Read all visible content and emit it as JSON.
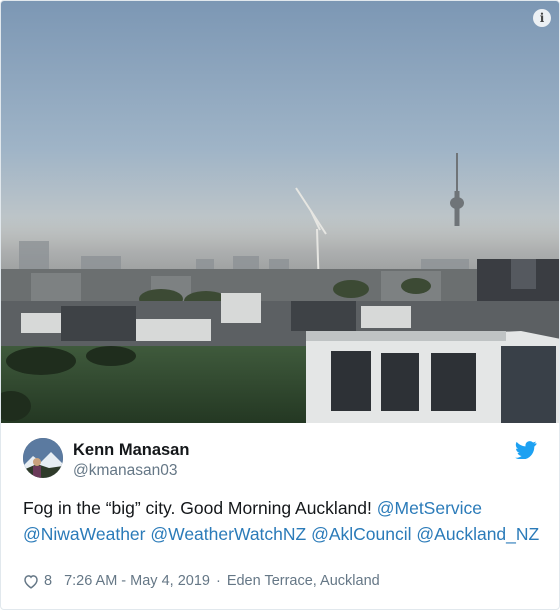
{
  "colors": {
    "link": "#2b7bb9",
    "secondary_text": "#657786",
    "twitter_blue": "#1da1f2",
    "sky_top": "#7f99b5",
    "sky_horizon": "#d9cdb8"
  },
  "media": {
    "info_icon": "info-icon",
    "info_glyph": "i"
  },
  "user": {
    "display_name": "Kenn Manasan",
    "handle": "@kmanasan03",
    "avatar": "avatar"
  },
  "brand_icon": "twitter-bird-icon",
  "tweet": {
    "text_parts": [
      {
        "type": "text",
        "value": "Fog in the “big” city. Good Morning Auckland! "
      },
      {
        "type": "mention",
        "value": "@MetService"
      },
      {
        "type": "text",
        "value": " "
      },
      {
        "type": "mention",
        "value": "@NiwaWeather"
      },
      {
        "type": "text",
        "value": " "
      },
      {
        "type": "mention",
        "value": "@WeatherWatchNZ"
      },
      {
        "type": "text",
        "value": " "
      },
      {
        "type": "mention",
        "value": "@AklCouncil"
      },
      {
        "type": "text",
        "value": " "
      },
      {
        "type": "mention",
        "value": "@Auckland_NZ"
      }
    ]
  },
  "meta": {
    "heart_icon": "heart-icon",
    "like_count": "8",
    "timestamp": "7:26 AM - May 4, 2019",
    "separator": "·",
    "place": "Eden Terrace, Auckland"
  }
}
